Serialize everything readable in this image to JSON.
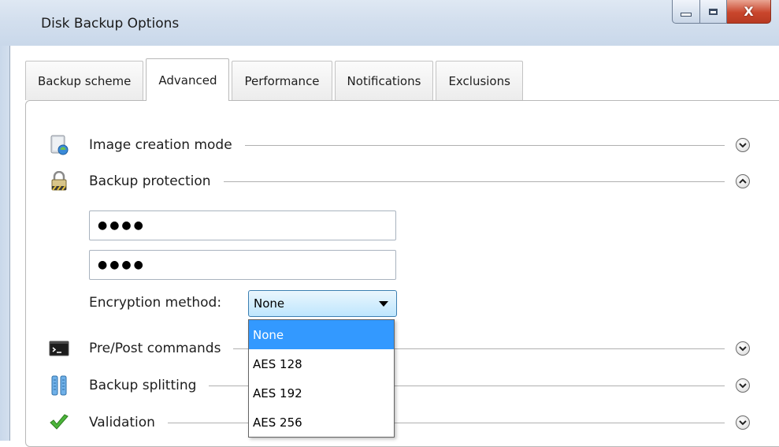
{
  "window": {
    "title": "Disk Backup Options",
    "close_glyph": "X"
  },
  "tabs": [
    {
      "label": "Backup scheme",
      "active": false
    },
    {
      "label": "Advanced",
      "active": true
    },
    {
      "label": "Performance",
      "active": false
    },
    {
      "label": "Notifications",
      "active": false
    },
    {
      "label": "Exclusions",
      "active": false
    }
  ],
  "sections": {
    "image_creation_mode": {
      "label": "Image creation mode",
      "state": "collapsed",
      "icon": "disk-image-icon"
    },
    "backup_protection": {
      "label": "Backup protection",
      "state": "expanded",
      "icon": "padlock-icon"
    },
    "pre_post_commands": {
      "label": "Pre/Post commands",
      "state": "collapsed",
      "icon": "terminal-icon"
    },
    "backup_splitting": {
      "label": "Backup splitting",
      "state": "collapsed",
      "icon": "split-icon"
    },
    "validation": {
      "label": "Validation",
      "state": "collapsed",
      "icon": "checkmark-icon"
    }
  },
  "protection": {
    "password": "●●●●",
    "confirm_password": "●●●●",
    "encryption_label": "Encryption method:",
    "encryption_selected": "None",
    "encryption_options": [
      "None",
      "AES 128",
      "AES 192",
      "AES 256"
    ]
  },
  "colors": {
    "selection": "#3399ff",
    "titlebar": "#d3dfee",
    "close": "#c9462c"
  }
}
